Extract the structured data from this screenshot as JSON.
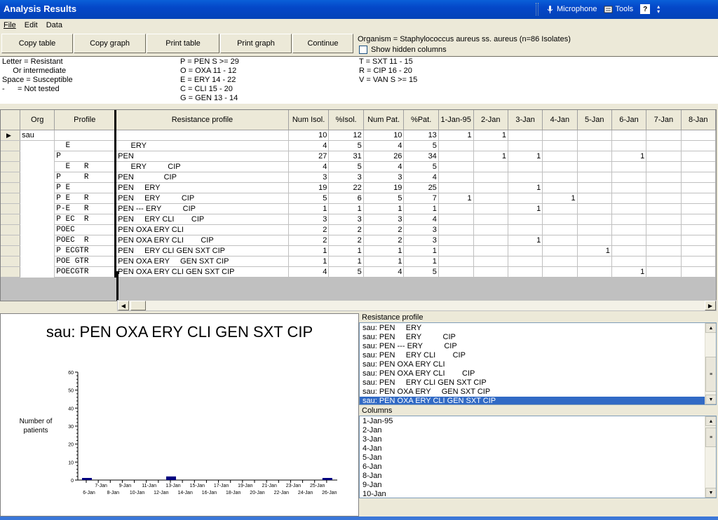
{
  "window": {
    "title": "Analysis Results"
  },
  "langbar": {
    "microphone": "Microphone",
    "tools": "Tools"
  },
  "menu": {
    "file": "File",
    "edit": "Edit",
    "data": "Data"
  },
  "toolbar": {
    "copy_table": "Copy table",
    "copy_graph": "Copy graph",
    "print_table": "Print table",
    "print_graph": "Print graph",
    "continue": "Continue"
  },
  "organism_text": "Organism = Staphylococcus aureus ss. aureus   (n=86 Isolates)",
  "show_hidden_label": "Show hidden columns",
  "legend": {
    "col1": [
      "Letter = Resistant",
      "     Or intermediate",
      "Space = Susceptible",
      "-      = Not tested"
    ],
    "col2": [
      "P = PEN S >= 29",
      "O = OXA 11 - 12",
      "E = ERY 14 - 22",
      "C = CLI 15 - 20",
      "G = GEN 13 - 14"
    ],
    "col3": [
      "T = SXT 11 - 15",
      "R = CIP 16 - 20",
      "V = VAN S >= 15"
    ]
  },
  "grid": {
    "columns": [
      "Org",
      "Profile",
      "Resistance profile",
      "Num Isol.",
      "%Isol.",
      "Num Pat.",
      "%Pat.",
      "1-Jan-95",
      "2-Jan",
      "3-Jan",
      "4-Jan",
      "5-Jan",
      "6-Jan",
      "7-Jan",
      "8-Jan"
    ],
    "rows": [
      {
        "org": "sau",
        "profile": "",
        "rp": "",
        "ni": "10",
        "pi": "12",
        "np": "10",
        "pp": "13",
        "d": [
          "1",
          "1",
          "",
          "",
          "",
          "",
          "",
          ""
        ]
      },
      {
        "org": "",
        "profile": "  E",
        "rp": "      ERY",
        "ni": "4",
        "pi": "5",
        "np": "4",
        "pp": "5",
        "d": [
          "",
          "",
          "",
          "",
          "",
          "",
          "",
          ""
        ]
      },
      {
        "org": "",
        "profile": "P",
        "rp": "PEN",
        "ni": "27",
        "pi": "31",
        "np": "26",
        "pp": "34",
        "d": [
          "",
          "1",
          "1",
          "",
          "",
          "1",
          "",
          ""
        ]
      },
      {
        "org": "",
        "profile": "  E   R",
        "rp": "      ERY          CIP",
        "ni": "4",
        "pi": "5",
        "np": "4",
        "pp": "5",
        "d": [
          "",
          "",
          "",
          "",
          "",
          "",
          "",
          ""
        ]
      },
      {
        "org": "",
        "profile": "P     R",
        "rp": "PEN              CIP",
        "ni": "3",
        "pi": "3",
        "np": "3",
        "pp": "4",
        "d": [
          "",
          "",
          "",
          "",
          "",
          "",
          "",
          ""
        ]
      },
      {
        "org": "",
        "profile": "P E",
        "rp": "PEN     ERY",
        "ni": "19",
        "pi": "22",
        "np": "19",
        "pp": "25",
        "d": [
          "",
          "",
          "1",
          "",
          "",
          "",
          "",
          ""
        ]
      },
      {
        "org": "",
        "profile": "P E   R",
        "rp": "PEN     ERY          CIP",
        "ni": "5",
        "pi": "6",
        "np": "5",
        "pp": "7",
        "d": [
          "1",
          "",
          "",
          "1",
          "",
          "",
          "",
          ""
        ]
      },
      {
        "org": "",
        "profile": "P-E   R",
        "rp": "PEN --- ERY          CIP",
        "ni": "1",
        "pi": "1",
        "np": "1",
        "pp": "1",
        "d": [
          "",
          "",
          "1",
          "",
          "",
          "",
          "",
          ""
        ]
      },
      {
        "org": "",
        "profile": "P EC  R",
        "rp": "PEN     ERY CLI        CIP",
        "ni": "3",
        "pi": "3",
        "np": "3",
        "pp": "4",
        "d": [
          "",
          "",
          "",
          "",
          "",
          "",
          "",
          ""
        ]
      },
      {
        "org": "",
        "profile": "POEC",
        "rp": "PEN OXA ERY CLI",
        "ni": "2",
        "pi": "2",
        "np": "2",
        "pp": "3",
        "d": [
          "",
          "",
          "",
          "",
          "",
          "",
          "",
          ""
        ]
      },
      {
        "org": "",
        "profile": "POEC  R",
        "rp": "PEN OXA ERY CLI        CIP",
        "ni": "2",
        "pi": "2",
        "np": "2",
        "pp": "3",
        "d": [
          "",
          "",
          "1",
          "",
          "",
          "",
          "",
          ""
        ]
      },
      {
        "org": "",
        "profile": "P ECGTR",
        "rp": "PEN     ERY CLI GEN SXT CIP",
        "ni": "1",
        "pi": "1",
        "np": "1",
        "pp": "1",
        "d": [
          "",
          "",
          "",
          "",
          "1",
          "",
          "",
          ""
        ]
      },
      {
        "org": "",
        "profile": "POE GTR",
        "rp": "PEN OXA ERY     GEN SXT CIP",
        "ni": "1",
        "pi": "1",
        "np": "1",
        "pp": "1",
        "d": [
          "",
          "",
          "",
          "",
          "",
          "",
          "",
          ""
        ]
      },
      {
        "org": "",
        "profile": "POECGTR",
        "rp": "PEN OXA ERY CLI GEN SXT CIP",
        "ni": "4",
        "pi": "5",
        "np": "4",
        "pp": "5",
        "d": [
          "",
          "",
          "",
          "",
          "",
          "1",
          "",
          ""
        ]
      }
    ]
  },
  "chart_data": {
    "type": "bar",
    "title": "sau: PEN OXA ERY CLI GEN SXT CIP",
    "ylabel": "Number of patients",
    "ylim": [
      0,
      60
    ],
    "yticks": [
      0,
      10,
      20,
      30,
      40,
      50,
      60
    ],
    "categories": [
      "6-Jan",
      "7-Jan",
      "8-Jan",
      "9-Jan",
      "10-Jan",
      "11-Jan",
      "12-Jan",
      "13-Jan",
      "14-Jan",
      "15-Jan",
      "16-Jan",
      "17-Jan",
      "18-Jan",
      "19-Jan",
      "20-Jan",
      "21-Jan",
      "22-Jan",
      "23-Jan",
      "24-Jan",
      "25-Jan",
      "26-Jan"
    ],
    "values": [
      1,
      0,
      0,
      0,
      0,
      0,
      0,
      2,
      0,
      0,
      0,
      0,
      0,
      0,
      0,
      0,
      0,
      0,
      0,
      0,
      1
    ],
    "bar_color": "#000080"
  },
  "resistance_profile_panel": {
    "label": "Resistance profile",
    "items": [
      "sau: PEN     ERY",
      "sau: PEN     ERY          CIP",
      "sau: PEN --- ERY          CIP",
      "sau: PEN     ERY CLI        CIP",
      "sau: PEN OXA ERY CLI",
      "sau: PEN OXA ERY CLI        CIP",
      "sau: PEN     ERY CLI GEN SXT CIP",
      "sau: PEN OXA ERY     GEN SXT CIP",
      "sau: PEN OXA ERY CLI GEN SXT CIP"
    ],
    "selected_index": 8
  },
  "columns_panel": {
    "label": "Columns",
    "items": [
      "1-Jan-95",
      "2-Jan",
      "3-Jan",
      "4-Jan",
      "5-Jan",
      "6-Jan",
      "8-Jan",
      "9-Jan",
      "10-Jan"
    ]
  },
  "colors": {
    "titlebar": "#0446c8",
    "selection": "#316ac5",
    "face": "#ece9d8"
  }
}
